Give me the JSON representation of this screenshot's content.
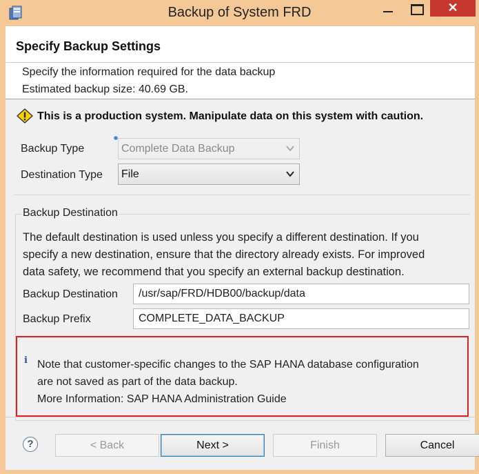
{
  "window": {
    "title": "Backup of System FRD",
    "close_glyph": "✕"
  },
  "header": {
    "page_title": "Specify Backup Settings",
    "description": "Specify the information required for the data backup",
    "estimated_size": "Estimated backup size: 40.69 GB."
  },
  "warning": {
    "text": "This is a production system. Manipulate data on this system with caution.",
    "icon": "warning-icon"
  },
  "form": {
    "backup_type_label": "Backup Type",
    "backup_type_value": "Complete Data Backup",
    "destination_type_label": "Destination Type",
    "destination_type_value": "File"
  },
  "destination_group": {
    "title": "Backup Destination",
    "help_line1": "The default destination is used unless you specify a different destination. If you",
    "help_line2": "specify a new destination, ensure that the directory already exists. For improved",
    "help_line3": "data safety, we recommend that you specify an external backup destination.",
    "destination_label": "Backup Destination",
    "destination_value": "/usr/sap/FRD/HDB00/backup/data",
    "prefix_label": "Backup Prefix",
    "prefix_value": "COMPLETE_DATA_BACKUP"
  },
  "note": {
    "icon_glyph": "i",
    "line1": "Note that customer-specific changes to the SAP HANA database configuration",
    "line2": "are not saved as part of the data backup.",
    "line3": "More Information: SAP HANA Administration Guide"
  },
  "buttons": {
    "help": "?",
    "back": "< Back",
    "next": "Next >",
    "finish": "Finish",
    "cancel": "Cancel"
  },
  "colors": {
    "title_bar": "#f3c896",
    "close_button": "#c7372f",
    "note_border": "#e02020",
    "warning_fill": "#f8d100"
  }
}
